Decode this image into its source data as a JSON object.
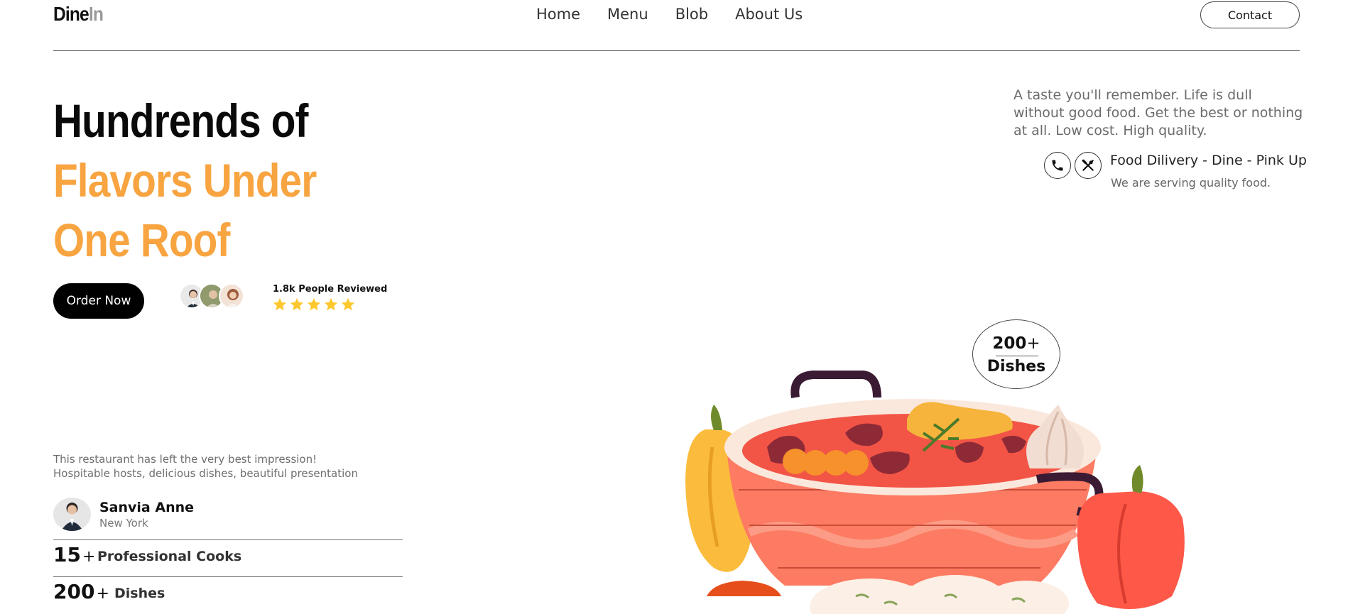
{
  "header": {
    "logo_part1": "Dine",
    "logo_part2": "In",
    "nav": [
      "Home",
      "Menu",
      "Blob",
      "About Us"
    ],
    "contact_label": "Contact"
  },
  "hero": {
    "title_line1": "Hundrends of",
    "title_line2": "Flavors Under",
    "title_line3": "One Roof",
    "order_label": "Order Now",
    "reviews_text": "1.8k People Reviewed",
    "rating": 5,
    "accent_color": "#f7a441",
    "star_color": "#fdc72e"
  },
  "intro": {
    "text": "A taste you'll remember. Life is dull without good food. Get the best or nothing at all. Low cost. High quality.",
    "delivery_title": "Food Dilivery - Dine - Pink Up",
    "delivery_sub": "We are serving quality food."
  },
  "testimonial": {
    "line1": "This restaurant has left the very best impression!",
    "line2": "Hospitable hosts, delicious dishes, beautiful presentation",
    "name": "Sanvia Anne",
    "city": "New York"
  },
  "stats": [
    {
      "number": "15",
      "plus": "+",
      "label": "Professional Cooks"
    },
    {
      "number": "200",
      "plus": "+",
      "label": "Dishes"
    }
  ],
  "badge": {
    "number": "200",
    "plus": "+",
    "label": "Dishes"
  },
  "icons": [
    "phone-icon",
    "cutlery-icon",
    "star-icon"
  ]
}
